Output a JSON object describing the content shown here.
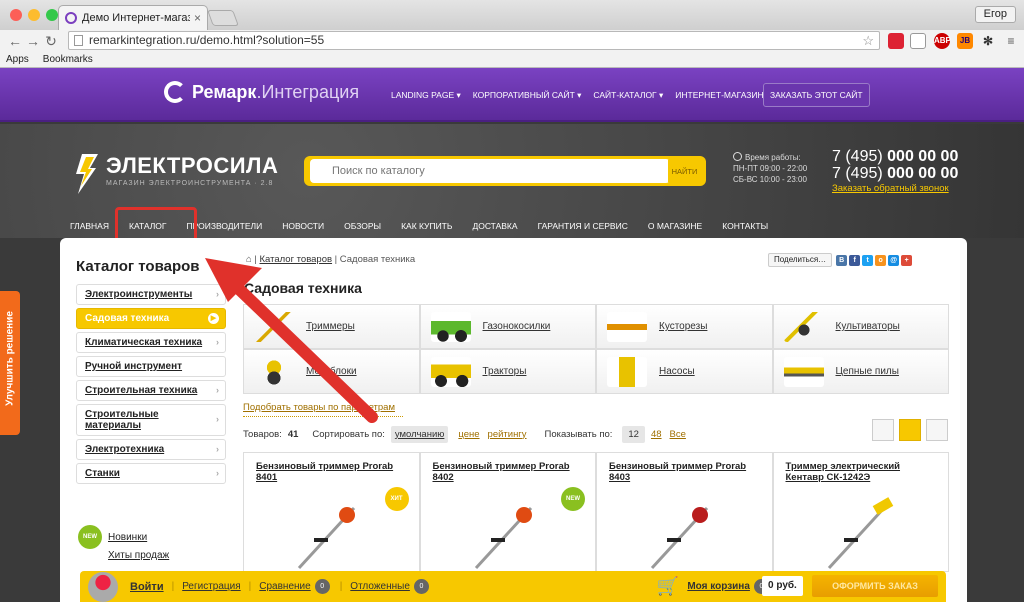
{
  "browser": {
    "tab_title": "Демо Интернет-магазин",
    "url": "remarkintegration.ru/demo.html?solution=55",
    "user": "Егор",
    "bookmarks": [
      "Apps",
      "Bookmarks"
    ],
    "extensions": [
      "ABP",
      "JB"
    ]
  },
  "remark_bar": {
    "logo_bold": "Ремарк",
    "logo_rest": ".Интеграция",
    "nav": [
      "LANDING PAGE ▾",
      "КОРПОРАТИВНЫЙ САЙТ ▾",
      "САЙТ-КАТАЛОГ ▾",
      "ИНТЕРНЕТ-МАГАЗИН ▾"
    ],
    "order_button": "ЗАКАЗАТЬ ЭТОТ САЙТ"
  },
  "store": {
    "name": "ЭЛЕКТРОСИЛА",
    "tagline": "МАГАЗИН ЭЛЕКТРОИНСТРУМЕНТА · 2.8",
    "search_placeholder": "Поиск по каталогу",
    "search_button": "НАЙТИ",
    "hours_title": "Время работы:",
    "hours_weekdays": "ПН-ПТ 09:00 - 22:00",
    "hours_weekend": "СБ-ВС 10:00 - 23:00",
    "phone_prefix": "7 (495)",
    "phone_number": "000 00 00",
    "callback": "Заказать обратный звонок",
    "nav": [
      "ГЛАВНАЯ",
      "КАТАЛОГ",
      "ПРОИЗВОДИТЕЛИ",
      "НОВОСТИ",
      "ОБЗОРЫ",
      "КАК КУПИТЬ",
      "ДОСТАВКА",
      "ГАРАНТИЯ И СЕРВИС",
      "О МАГАЗИНЕ",
      "КОНТАКТЫ"
    ]
  },
  "sidebar": {
    "title": "Каталог товаров",
    "categories": [
      {
        "label": "Электроинструменты",
        "selected": false
      },
      {
        "label": "Садовая техника",
        "selected": true
      },
      {
        "label": "Климатическая техника",
        "selected": false
      },
      {
        "label": "Ручной инструмент",
        "selected": false
      },
      {
        "label": "Строительная техника",
        "selected": false
      },
      {
        "label": "Строительные материалы",
        "selected": false
      },
      {
        "label": "Электротехника",
        "selected": false
      },
      {
        "label": "Станки",
        "selected": false
      }
    ],
    "links": [
      {
        "label": "Новинки",
        "badge": "NEW"
      },
      {
        "label": "Хиты продаж",
        "badge": ""
      }
    ]
  },
  "breadcrumb": {
    "home": "⌂",
    "catalog": "Каталог товаров",
    "current": "Садовая техника"
  },
  "share": {
    "label": "Поделиться…"
  },
  "page_title": "Садовая техника",
  "subcategories": [
    "Триммеры",
    "Газонокосилки",
    "Кусторезы",
    "Культиваторы",
    "Мотоблоки",
    "Тракторы",
    "Насосы",
    "Цепные пилы"
  ],
  "filter_link": "Подобрать товары по параметрам",
  "sortbar": {
    "count_label": "Товаров:",
    "count": "41",
    "sort_label": "Сортировать по:",
    "sort_selected": "умолчанию",
    "sort_options": [
      "цене",
      "рейтингу"
    ],
    "show_label": "Показывать по:",
    "page_sizes": [
      "12",
      "48",
      "Все"
    ]
  },
  "products": [
    {
      "name": "Бензиновый триммер Prorab 8401",
      "badge": "ХИТ"
    },
    {
      "name": "Бензиновый триммер Prorab 8402",
      "badge": "NEW"
    },
    {
      "name": "Бензиновый триммер Prorab 8403",
      "badge": ""
    },
    {
      "name": "Триммер электрический Кентавр СК-1242Э",
      "badge": ""
    }
  ],
  "bottom_bar": {
    "login": "Войти",
    "register": "Регистрация",
    "compare": "Сравнение",
    "compare_count": "0",
    "deferred": "Отложенные",
    "deferred_count": "0",
    "cart": "Моя корзина",
    "cart_count": "0",
    "price": "0 руб.",
    "checkout": "ОФОРМИТЬ ЗАКАЗ"
  },
  "improve_tab": "Улучшить решение",
  "colors": {
    "accent": "#f7c800",
    "purple": "#6a36ad",
    "highlight": "#e0312b",
    "orange_tab": "#f26a1b"
  }
}
